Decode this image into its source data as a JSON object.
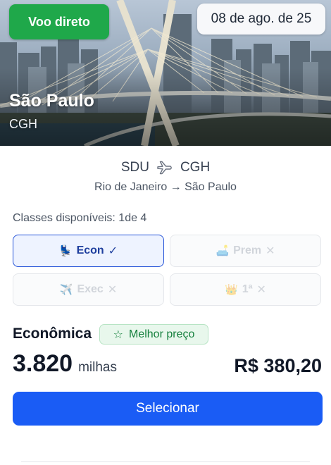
{
  "hero": {
    "badge_direct": "Voo direto",
    "date": "08 de ago. de 25",
    "city": "São Paulo",
    "airport_code": "CGH"
  },
  "route": {
    "origin": "SDU",
    "destination": "CGH",
    "icon": "plane-icon",
    "subtitle": "Rio de Janeiro → São Paulo"
  },
  "classes": {
    "label": "Classes disponíveis: 1de 4",
    "items": [
      {
        "icon": "💺",
        "icon_name": "seat-icon",
        "label": "Econ",
        "mark": "✓",
        "available": true,
        "selected": true
      },
      {
        "icon": "🛋️",
        "icon_name": "sofa-icon",
        "label": "Prem",
        "mark": "✕",
        "available": false,
        "selected": false
      },
      {
        "icon": "✈️",
        "icon_name": "airplane-icon",
        "label": "Exec",
        "mark": "✕",
        "available": false,
        "selected": false
      },
      {
        "icon": "👑",
        "icon_name": "crown-icon",
        "label": "1ª",
        "mark": "✕",
        "available": false,
        "selected": false
      }
    ]
  },
  "fare": {
    "class_name": "Econômica",
    "best_badge_icon": "☆",
    "best_badge": "Melhor preço",
    "miles": "3.820",
    "miles_unit": "milhas",
    "price": "R$ 380,20"
  },
  "action": {
    "select_label": "Selecionar"
  },
  "colors": {
    "primary": "#1a5cf5",
    "direct_badge": "#1fa84a",
    "best_badge_text": "#15803d",
    "selected_border": "#2553d8"
  }
}
